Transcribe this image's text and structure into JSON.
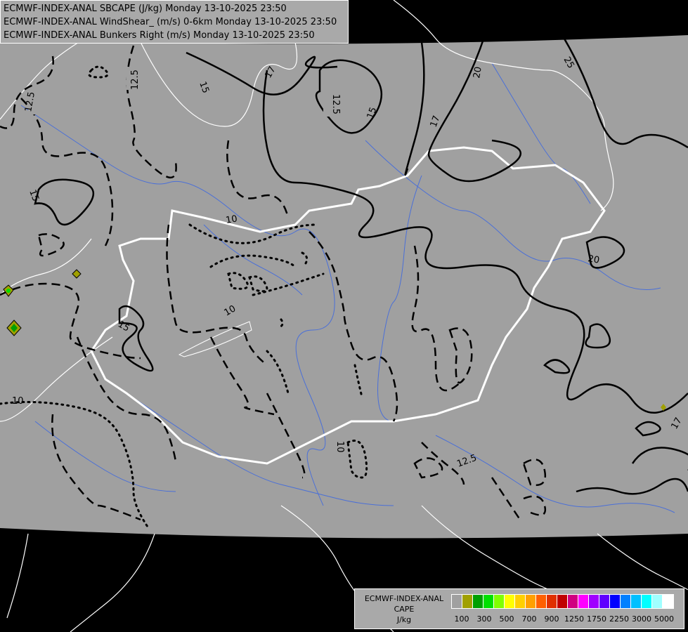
{
  "header": {
    "line1": "ECMWF-INDEX-ANAL SBCAPE (J/kg) Monday 13-10-2025 23:50",
    "line2": "ECMWF-INDEX-ANAL WindShear_ (m/s) 0-6km Monday 13-10-2025 23:50",
    "line3": "ECMWF-INDEX-ANAL Bunkers Right (m/s) Monday 13-10-2025 23:50"
  },
  "legend": {
    "title_line1": "ECMWF-INDEX-ANAL",
    "title_line2": "CAPE",
    "unit": "J/kg",
    "colors": [
      "#a0a0a0",
      "#a0a000",
      "#00a000",
      "#00e000",
      "#80ff00",
      "#ffff00",
      "#ffd000",
      "#ffa000",
      "#ff6000",
      "#e03000",
      "#c00000",
      "#d00080",
      "#ff00ff",
      "#a000ff",
      "#6000ff",
      "#0000ff",
      "#0080ff",
      "#00c0ff",
      "#00ffff",
      "#a0ffff",
      "#ffffff"
    ],
    "tick_labels": [
      "100",
      "300",
      "500",
      "700",
      "900",
      "1250",
      "1750",
      "2250",
      "3000",
      "5000"
    ]
  },
  "contour_labels": {
    "l1": "12.5",
    "l2": "12.5",
    "l3": "15",
    "l4": "17",
    "l5": "12.5",
    "l6": "15",
    "l7": "17",
    "l8": "20",
    "l9": "25",
    "l10": "15",
    "l11": "10",
    "l12": "10",
    "l13": "15",
    "l14": "20",
    "l15": "10",
    "l16": "10",
    "l17": "12.5",
    "l18": "17"
  },
  "colors": {
    "map_gray": "#a0a0a0",
    "background": "#000000",
    "border": "#ffffff",
    "river": "#4a6fd8"
  }
}
